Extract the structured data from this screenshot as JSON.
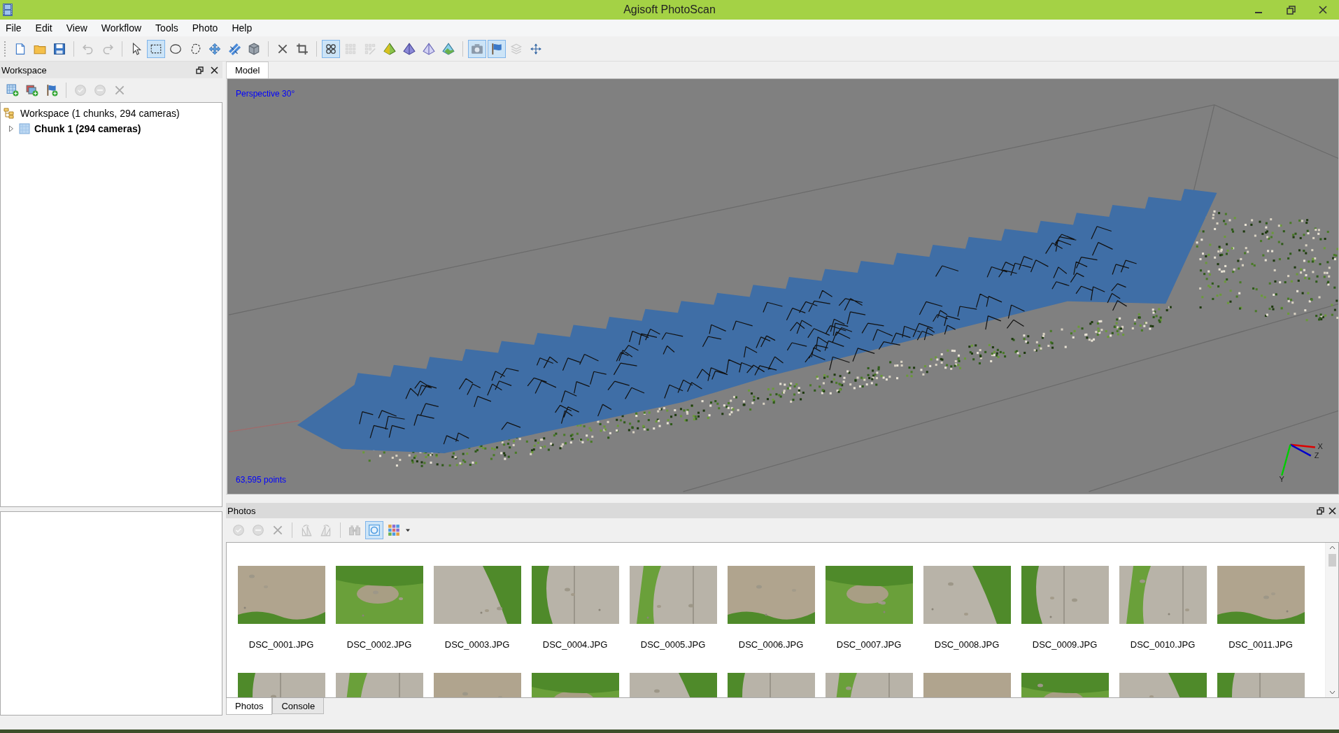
{
  "window": {
    "title": "Agisoft PhotoScan"
  },
  "menu": [
    "File",
    "Edit",
    "View",
    "Workflow",
    "Tools",
    "Photo",
    "Help"
  ],
  "toolbar": [
    [
      {
        "selected": false,
        "disabled": false
      },
      {
        "selected": false,
        "disabled": false
      },
      {
        "selected": false,
        "disabled": false
      }
    ],
    [
      {
        "selected": false,
        "disabled": true
      },
      {
        "selected": false,
        "disabled": true
      }
    ],
    [
      {
        "selected": false,
        "disabled": false
      },
      {
        "selected": true,
        "disabled": false
      },
      {
        "selected": false,
        "disabled": false
      },
      {
        "selected": false,
        "disabled": false
      },
      {
        "selected": false,
        "disabled": false
      },
      {
        "selected": false,
        "disabled": false
      },
      {
        "selected": false,
        "disabled": false
      }
    ],
    [
      {
        "selected": false,
        "disabled": false
      },
      {
        "selected": false,
        "disabled": false
      }
    ],
    [
      {
        "selected": true,
        "disabled": false
      },
      {
        "selected": false,
        "disabled": true
      },
      {
        "selected": false,
        "disabled": true
      },
      {
        "selected": false,
        "disabled": false
      },
      {
        "selected": false,
        "disabled": false
      },
      {
        "selected": false,
        "disabled": false
      },
      {
        "selected": false,
        "disabled": false
      }
    ],
    [
      {
        "selected": true,
        "disabled": false
      },
      {
        "selected": true,
        "disabled": false
      },
      {
        "selected": false,
        "disabled": true
      },
      {
        "selected": false,
        "disabled": false
      }
    ]
  ],
  "workspace": {
    "title": "Workspace",
    "toolbar": [
      [
        {
          "selected": false,
          "disabled": false
        },
        {
          "selected": false,
          "disabled": false
        },
        {
          "selected": false,
          "disabled": false
        }
      ],
      [
        {
          "selected": false,
          "disabled": true
        },
        {
          "selected": false,
          "disabled": true
        },
        {
          "selected": false,
          "disabled": true
        }
      ]
    ],
    "tree": {
      "label": "Workspace (1 chunks, 294 cameras)",
      "children": [
        {
          "label": "Chunk 1 (294 cameras)",
          "expanded": false
        }
      ]
    }
  },
  "view_tabs": [
    {
      "label": "Model",
      "selected": true
    }
  ],
  "viewport": {
    "projection": "Perspective 30°",
    "point_count": "63,595 points",
    "axes": [
      "X",
      "Z",
      "Y"
    ]
  },
  "photos": {
    "title": "Photos",
    "toolbar": [
      [
        {
          "selected": false,
          "disabled": true
        },
        {
          "selected": false,
          "disabled": true
        },
        {
          "selected": false,
          "disabled": true
        }
      ],
      [
        {
          "selected": false,
          "disabled": true
        },
        {
          "selected": false,
          "disabled": true
        }
      ],
      [
        {
          "selected": false,
          "disabled": true
        },
        {
          "selected": true,
          "disabled": false
        },
        {
          "selected": false,
          "disabled": false
        }
      ]
    ],
    "items": [
      {
        "label": "DSC_0001.JPG"
      },
      {
        "label": "DSC_0002.JPG"
      },
      {
        "label": "DSC_0003.JPG"
      },
      {
        "label": "DSC_0004.JPG"
      },
      {
        "label": "DSC_0005.JPG"
      },
      {
        "label": "DSC_0006.JPG"
      },
      {
        "label": "DSC_0007.JPG"
      },
      {
        "label": "DSC_0008.JPG"
      },
      {
        "label": "DSC_0009.JPG"
      },
      {
        "label": "DSC_0010.JPG"
      },
      {
        "label": "DSC_0011.JPG"
      }
    ],
    "next_row": [
      {
        "kind": "picture"
      },
      {
        "kind": "picture"
      },
      {
        "kind": "picture"
      },
      {
        "kind": "picture"
      },
      {
        "kind": "picture"
      },
      {
        "kind": "picture"
      },
      {
        "kind": "picture"
      },
      {
        "kind": "picture"
      },
      {
        "kind": "picture"
      },
      {
        "kind": "picture"
      },
      {
        "kind": "picture"
      }
    ]
  },
  "bottom_tabs": [
    {
      "label": "Photos",
      "selected": true
    },
    {
      "label": "Console",
      "selected": false
    }
  ]
}
